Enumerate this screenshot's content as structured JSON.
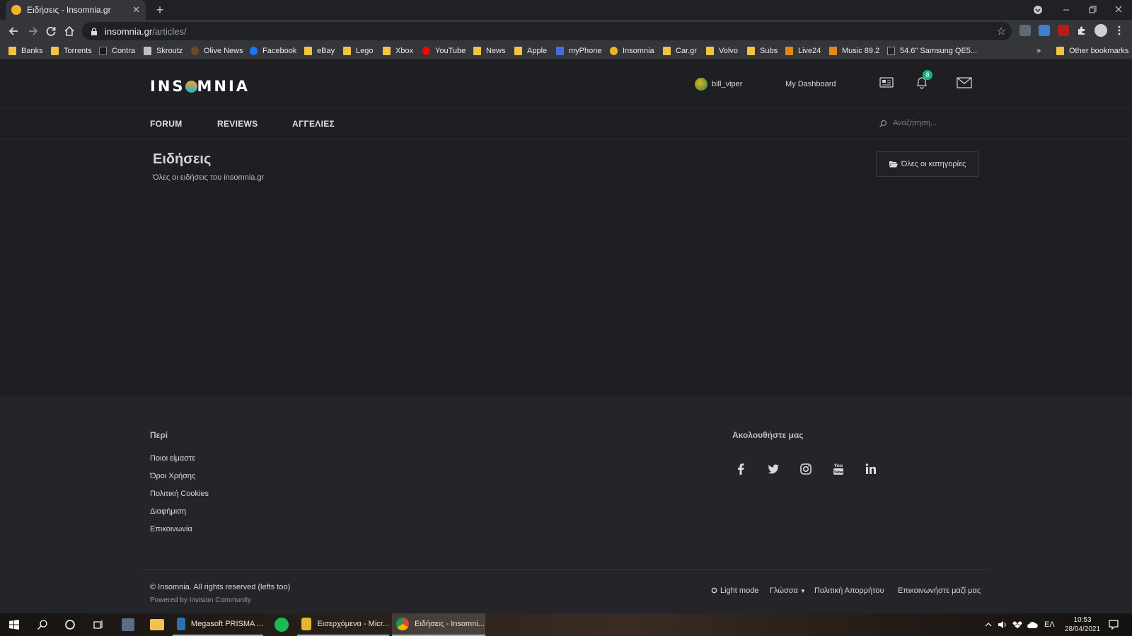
{
  "browser": {
    "tab_title": "Ειδήσεις - Insomnia.gr",
    "tab_close": "✕",
    "new_tab": "+",
    "url_host": "insomnia.gr",
    "url_path": "/articles/",
    "bookmarks": [
      "Banks",
      "Torrents",
      "Contra",
      "Skroutz",
      "Olive News",
      "Facebook",
      "eBay",
      "Lego",
      "Xbox",
      "YouTube",
      "News",
      "Apple",
      "myPhone",
      "Insomnia",
      "Car.gr",
      "Volvo",
      "Subs",
      "Live24",
      "Music 89.2",
      "54.6\" Samsung QE5..."
    ],
    "bookmarks_more": "»",
    "other_bookmarks": "Other bookmarks"
  },
  "header": {
    "logo_left": "INS",
    "logo_right": "MNIA",
    "username": "bill_viper",
    "dashboard": "My Dashboard",
    "notification_count": "8"
  },
  "nav": {
    "items": [
      "FORUM",
      "REVIEWS",
      "ΑΓΓΕΛΙΕΣ"
    ],
    "search_placeholder": "Αναζήτηση..."
  },
  "page": {
    "title": "Ειδήσεις",
    "subtitle": "Όλες οι ειδήσεις του insomnia.gr",
    "categories_button": "Όλες οι κατηγορίες"
  },
  "footer": {
    "about_heading": "Περί",
    "links": [
      "Ποιοι είμαστε",
      "Όροι Χρήσης",
      "Πολιτική Cookies",
      "Διαφήμιση",
      "Επικοινωνία"
    ],
    "follow_heading": "Ακολουθήστε μας",
    "social": [
      "facebook-icon",
      "twitter-icon",
      "instagram-icon",
      "youtube-icon",
      "linkedin-icon"
    ],
    "copyright": "© Insomnia. All rights reserved (lefts too)",
    "powered": "Powered by Invision Community",
    "light_mode": "Light mode",
    "language": "Γλώσσα",
    "privacy": "Πολιτική Απορρήτου",
    "contact": "Επικοινωνήστε μαζί μας"
  },
  "taskbar": {
    "apps": [
      "Megasoft PRISMA ...",
      "Εισερχόμενα - Micr...",
      "Ειδήσεις - Insomni..."
    ],
    "lang": "ΕΛ",
    "time": "10:53",
    "date": "28/04/2021"
  },
  "colors": {
    "page_bg": "#1d1f22",
    "footer_bg": "#232529",
    "badge": "#1bb57a"
  }
}
